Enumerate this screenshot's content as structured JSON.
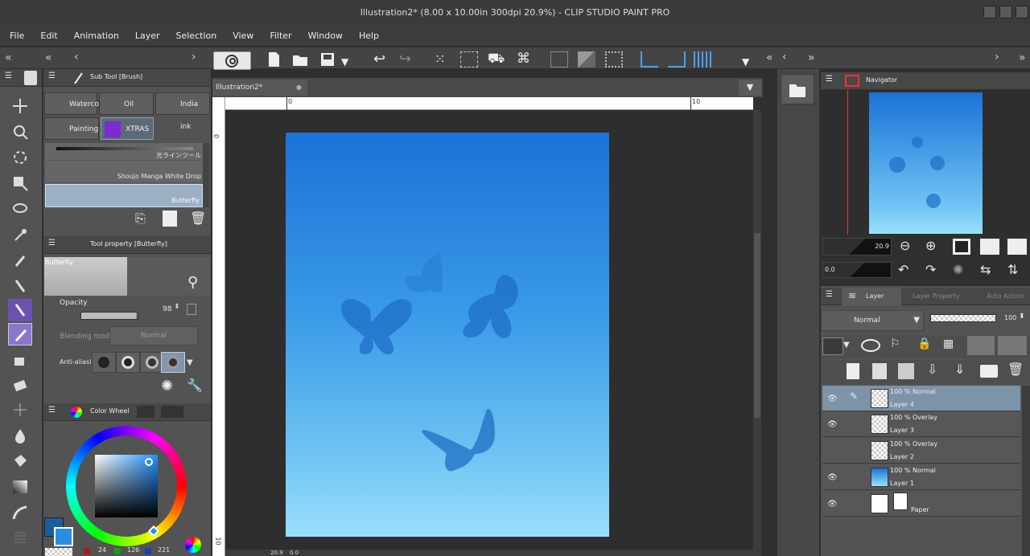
{
  "window": {
    "title": "Illustration2* (8.00 x 10.00in 300dpi 20.9%) - CLIP STUDIO PAINT PRO"
  },
  "menu": [
    "File",
    "Edit",
    "Animation",
    "Layer",
    "Selection",
    "View",
    "Filter",
    "Window",
    "Help"
  ],
  "canvas_tab": {
    "label": "Illustration2*"
  },
  "ruler": {
    "top_0": "0",
    "top_10": "10",
    "left_0": "0",
    "left_10": "10"
  },
  "subtool": {
    "title": "Sub Tool [Brush]",
    "brushes": [
      "Waterco",
      "Oil paint",
      "India ink",
      "Painting",
      "XTRAS"
    ],
    "list": [
      "光ラインツール",
      "Shoujo Manga White Drop",
      "Butterfly"
    ]
  },
  "toolprop": {
    "title": "Tool property [Butterfly]",
    "brush_name": "Butterfly",
    "opacity_label": "Opacity",
    "opacity_value": "98",
    "blend_label": "Blending mode",
    "blend_value": "Normal",
    "aa_label": "Anti-aliasing"
  },
  "color": {
    "title": "Color Wheel",
    "r": "24",
    "g": "126",
    "b": "221",
    "main": "#185e9b",
    "sub": "#2a8ee0"
  },
  "navigator": {
    "title": "Navigator",
    "zoom": "20.9",
    "rotate": "0.0"
  },
  "layers": {
    "tabs": [
      "Layer",
      "Layer Property",
      "Auto Action"
    ],
    "blend": "Normal",
    "opacity": "100",
    "rows": [
      {
        "mode": "100 % Normal",
        "name": "Layer 4"
      },
      {
        "mode": "100 % Overlay",
        "name": "Layer 3"
      },
      {
        "mode": "100 % Overlay",
        "name": "Layer 2"
      },
      {
        "mode": "100 % Normal",
        "name": "Layer 1"
      },
      {
        "mode": "",
        "name": "Paper"
      }
    ]
  },
  "statusbar": {
    "zoom": "20.9",
    "angle": "0.0"
  }
}
